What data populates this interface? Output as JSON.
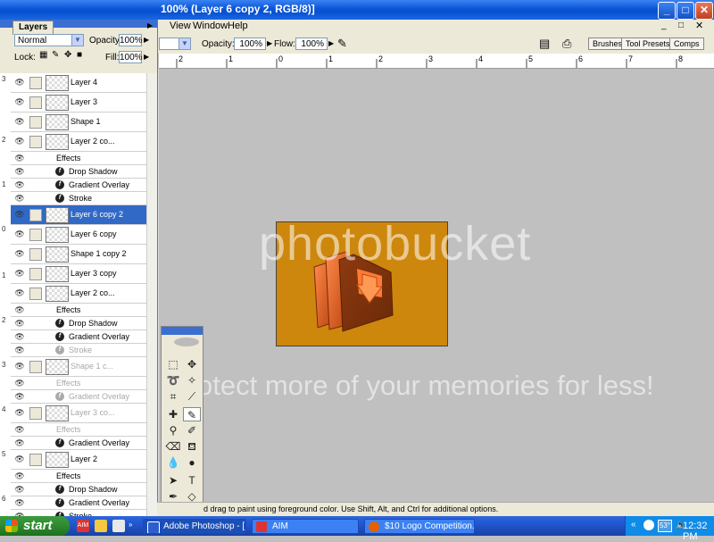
{
  "window": {
    "title": "100% (Layer 6 copy 2, RGB/8)]",
    "min": "_",
    "max": "□",
    "close": "✕"
  },
  "menu": {
    "items": [
      "View",
      "Window",
      "Help"
    ]
  },
  "options": {
    "blend_mode": "Normal",
    "opacity_label": "Opacity:",
    "opacity_value": "100%",
    "flow_label": "Flow:",
    "flow_value": "100%",
    "docks": [
      "Brushes",
      "Tool Presets",
      "Comps"
    ]
  },
  "ruler": {
    "ticks": [
      "2",
      "1",
      "0",
      "1",
      "2",
      "3",
      "4",
      "5",
      "6",
      "7",
      "8"
    ]
  },
  "layers_panel": {
    "tab": "Layers",
    "blend": "Normal",
    "opacity_label": "Opacity:",
    "opacity": "100%",
    "lock_label": "Lock:",
    "fill_label": "Fill:",
    "fill": "100%",
    "rows": [
      {
        "kind": "layer",
        "name": "Layer 4"
      },
      {
        "kind": "layer",
        "name": "Layer 3"
      },
      {
        "kind": "layer",
        "name": "Shape 1"
      },
      {
        "kind": "layer",
        "name": "Layer 2 co..."
      },
      {
        "kind": "effects",
        "name": "Effects"
      },
      {
        "kind": "fx",
        "name": "Drop Shadow"
      },
      {
        "kind": "fx",
        "name": "Gradient Overlay"
      },
      {
        "kind": "fx",
        "name": "Stroke"
      },
      {
        "kind": "layer",
        "name": "Layer 6 copy 2",
        "selected": true
      },
      {
        "kind": "layer",
        "name": "Layer 6 copy"
      },
      {
        "kind": "layer",
        "name": "Shape 1 copy 2"
      },
      {
        "kind": "layer",
        "name": "Layer 3 copy"
      },
      {
        "kind": "layer",
        "name": "Layer 2 co..."
      },
      {
        "kind": "effects",
        "name": "Effects"
      },
      {
        "kind": "fx",
        "name": "Drop Shadow"
      },
      {
        "kind": "fx",
        "name": "Gradient Overlay"
      },
      {
        "kind": "fx",
        "name": "Stroke",
        "dim": true
      },
      {
        "kind": "layer",
        "name": "Shape 1 c...",
        "dim": true
      },
      {
        "kind": "effects",
        "name": "Effects",
        "dim": true
      },
      {
        "kind": "fx",
        "name": "Gradient Overlay",
        "dim": true
      },
      {
        "kind": "layer",
        "name": "Layer 3 co...",
        "dim": true
      },
      {
        "kind": "effects",
        "name": "Effects",
        "dim": true
      },
      {
        "kind": "fx",
        "name": "Gradient Overlay"
      },
      {
        "kind": "layer",
        "name": "Layer 2"
      },
      {
        "kind": "effects",
        "name": "Effects"
      },
      {
        "kind": "fx",
        "name": "Drop Shadow"
      },
      {
        "kind": "fx",
        "name": "Gradient Overlay"
      },
      {
        "kind": "fx",
        "name": "Stroke"
      }
    ],
    "left_ruler": [
      "3",
      "2",
      "1",
      "0",
      "1",
      "2",
      "3",
      "4",
      "5",
      "6"
    ]
  },
  "watermark": {
    "brand": "photobucket",
    "tagline": "Protect more of your memories for less!"
  },
  "status": {
    "text": "d drag to paint using foreground color.  Use Shift, Alt, and Ctrl for additional options."
  },
  "taskbar": {
    "start": "start",
    "buttons": [
      "Adobe Photoshop - [...",
      "AIM",
      "$10 Logo Competition..."
    ],
    "temp": "53°",
    "clock": "12:32 PM"
  },
  "colors": {
    "canvas_bg": "#c0c0c0",
    "doc_fill": "#cd870c",
    "selected_row": "#3169c6",
    "folder_orange": "#f07030"
  }
}
